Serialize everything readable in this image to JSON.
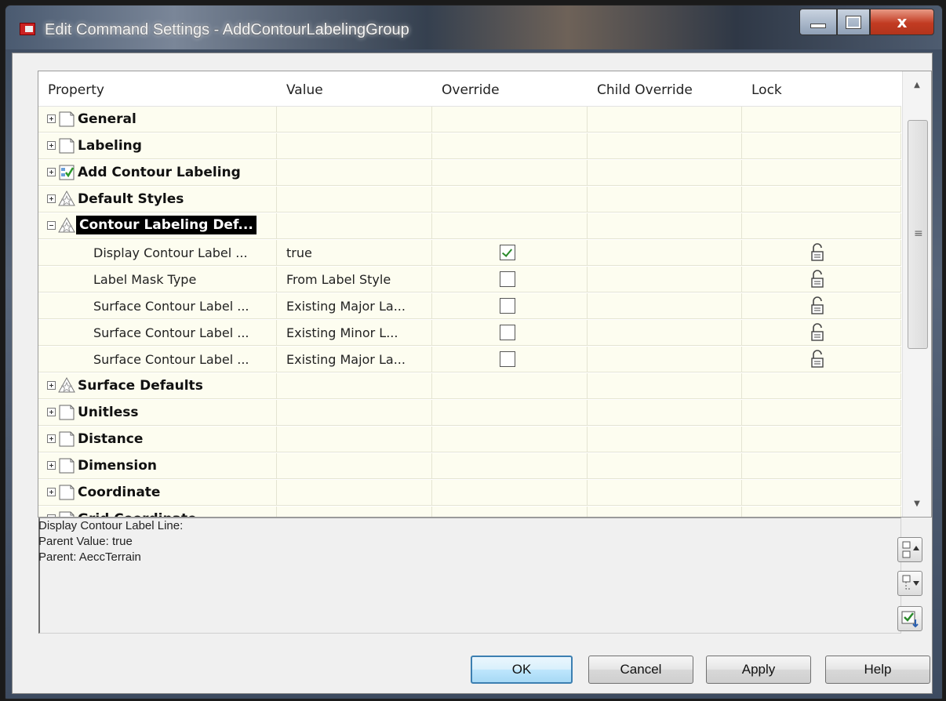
{
  "window": {
    "title": "Edit Command Settings - AddContourLabelingGroup",
    "close_glyph": "x"
  },
  "grid": {
    "columns": [
      "Property",
      "Value",
      "Override",
      "Child Override",
      "Lock"
    ],
    "rows": [
      {
        "type": "group",
        "label": "General",
        "icon": "document-icon",
        "expanded": false
      },
      {
        "type": "group",
        "label": "Labeling",
        "icon": "document-icon",
        "expanded": false
      },
      {
        "type": "group",
        "label": "Add Contour Labeling",
        "icon": "command-check-icon",
        "expanded": false
      },
      {
        "type": "group",
        "label": "Default Styles",
        "icon": "style-star-icon",
        "expanded": false
      },
      {
        "type": "group",
        "label": "Contour Labeling Def...",
        "icon": "style-star-icon",
        "expanded": true,
        "selected": true
      },
      {
        "type": "property",
        "label": "Display Contour Label ...",
        "value": "true",
        "override": true,
        "locked": true
      },
      {
        "type": "property",
        "label": "Label Mask Type",
        "value": "From Label Style",
        "override": false,
        "locked": true
      },
      {
        "type": "property",
        "label": "Surface Contour Label ...",
        "value": "Existing Major La...",
        "override": false,
        "locked": true
      },
      {
        "type": "property",
        "label": "Surface Contour Label ...",
        "value": "Existing Minor L...",
        "override": false,
        "locked": true
      },
      {
        "type": "property",
        "label": "Surface Contour Label ...",
        "value": "Existing Major La...",
        "override": false,
        "locked": true
      },
      {
        "type": "group",
        "label": "Surface Defaults",
        "icon": "style-star-icon",
        "expanded": false
      },
      {
        "type": "group",
        "label": "Unitless",
        "icon": "document-icon",
        "expanded": false
      },
      {
        "type": "group",
        "label": "Distance",
        "icon": "document-icon",
        "expanded": false
      },
      {
        "type": "group",
        "label": "Dimension",
        "icon": "document-icon",
        "expanded": false
      },
      {
        "type": "group",
        "label": "Coordinate",
        "icon": "document-icon",
        "expanded": false
      },
      {
        "type": "group",
        "label": "Grid Coordinate",
        "icon": "document-icon",
        "expanded": false
      }
    ]
  },
  "description": {
    "line1": "Display Contour Label Line:",
    "line2": "Parent Value: true",
    "line3": "Parent: AeccTerrain"
  },
  "side_buttons": [
    "move-up-icon",
    "move-down-icon",
    "check-apply-icon"
  ],
  "buttons": {
    "ok": "OK",
    "cancel": "Cancel",
    "apply": "Apply",
    "help": "Help"
  }
}
